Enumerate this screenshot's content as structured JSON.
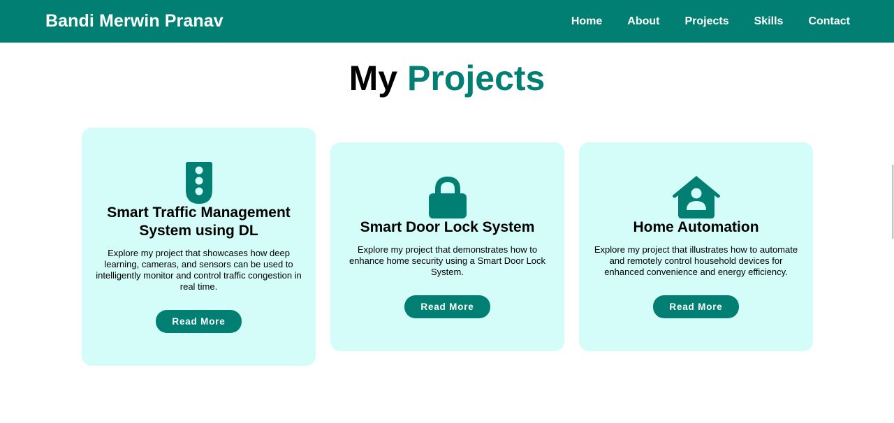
{
  "brand": "Bandi Merwin Pranav",
  "nav": {
    "items": [
      {
        "label": "Home"
      },
      {
        "label": "About"
      },
      {
        "label": "Projects"
      },
      {
        "label": "Skills"
      },
      {
        "label": "Contact"
      }
    ]
  },
  "section": {
    "title_part1": "My",
    "title_part2": "Projects"
  },
  "projects": [
    {
      "icon": "traffic-light-icon",
      "title": "Smart Traffic Management System using DL",
      "description": "Explore my project that showcases how deep learning, cameras, and sensors can be used to intelligently monitor and control traffic congestion in real time.",
      "button": "Read More"
    },
    {
      "icon": "lock-icon",
      "title": "Smart Door Lock System",
      "description": "Explore my project that demonstrates how to enhance home security using a Smart Door Lock System.",
      "button": "Read More"
    },
    {
      "icon": "house-user-icon",
      "title": "Home Automation",
      "description": "Explore my project that illustrates how to automate and remotely control household devices for enhanced convenience and energy efficiency.",
      "button": "Read More"
    }
  ],
  "colors": {
    "accent": "#007f72",
    "card_bg": "#d4fcf8",
    "nav_text": "#ffffff"
  }
}
